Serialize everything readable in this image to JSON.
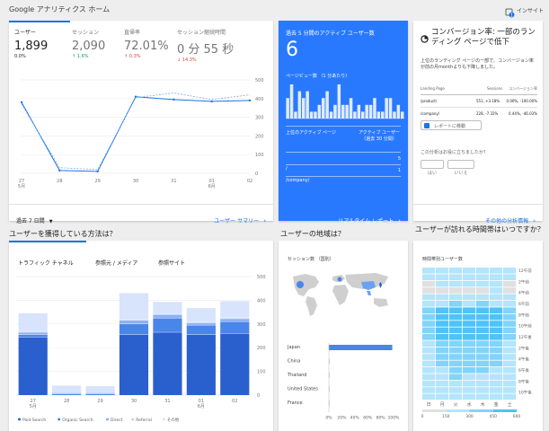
{
  "header": {
    "title": "Google アナリティクス ホーム",
    "insight_label": "インサイト",
    "insight_badge": "1"
  },
  "overview": {
    "metrics": [
      {
        "label": "ユーザー",
        "value": "1,899",
        "delta": "0.0%",
        "dir": "flat"
      },
      {
        "label": "セッション",
        "value": "2,090",
        "delta": "1.6%",
        "dir": "up"
      },
      {
        "label": "直帰率",
        "value": "72.01%",
        "delta": "0.3%",
        "dir": "down"
      },
      {
        "label": "セッション継続時間",
        "value": "0 分 55 秒",
        "delta": "14.3%",
        "dir": "down"
      }
    ],
    "chart_data": {
      "type": "line",
      "x": [
        "27 5月",
        "28",
        "29",
        "30",
        "31",
        "01 6月",
        "02"
      ],
      "xticks": [
        [
          "27",
          "5月"
        ],
        [
          "28"
        ],
        [
          "29"
        ],
        [
          "30"
        ],
        [
          "31"
        ],
        [
          "01",
          "6月"
        ],
        [
          "02"
        ]
      ],
      "series": [
        {
          "values": [
            380,
            15,
            10,
            410,
            395,
            385,
            390
          ],
          "style": "solid"
        },
        {
          "values": [
            370,
            30,
            20,
            405,
            430,
            395,
            420
          ],
          "style": "dashed"
        }
      ],
      "yticks": [
        "500",
        "400",
        "300",
        "200",
        "100",
        "0"
      ],
      "ylim": [
        0,
        500
      ]
    },
    "date_range": "過去 7 日間",
    "footer_link": "ユーザー サマリー"
  },
  "realtime": {
    "title": "過去 5 分間のアクティブ ユーザー数",
    "count": "6",
    "pageview_label": "ページビュー数 （1 分あたり）",
    "pageviews_per_min": [
      3,
      5,
      1,
      4,
      3,
      4,
      1,
      1,
      2,
      3,
      4,
      1,
      2,
      5,
      2,
      2,
      3,
      1,
      2,
      1,
      2,
      2,
      3,
      1,
      1,
      3,
      3,
      1,
      2,
      1
    ],
    "table_head_left": "上位のアクティブ ページ",
    "table_head_right": "アクティブ ユーザー （過去 30 分間）",
    "rows": [
      {
        "page": "/",
        "users": "5"
      },
      {
        "page": "/company/",
        "users": "1"
      }
    ],
    "footer_link": "リアルタイム レポート"
  },
  "conversion": {
    "title": "コンバージョン率: 一部のランディング ページで低下",
    "desc": "上位のランディング ページの一部で、コンバージョン率が前の月monthよりも下降しました。",
    "col_landing": "Landing Page",
    "col_sessions": "Sessions",
    "col_rate": "コンバージョン率",
    "rows": [
      {
        "page": "/product/",
        "sessions": "551, +3.18%",
        "rate": "0.00%, -100.00%"
      },
      {
        "page": "/company/",
        "sessions": "228, -7.32%",
        "rate": "0.44%, -46.03%"
      }
    ],
    "report_button": "レポートに移動",
    "question": "この分析はお役に立ちましたか？",
    "yes": "はい",
    "no": "いいえ",
    "footer_link": "その他の分析情報"
  },
  "acquisition": {
    "section_title": "ユーザーを獲得している方法は？",
    "tabs": [
      "トラフィック チャネル",
      "参照元 / メディア",
      "参照サイト"
    ],
    "chart_data": {
      "type": "bar",
      "categories": [
        "27 5月",
        "28",
        "29",
        "30",
        "31",
        "01 6月",
        "02"
      ],
      "xticks": [
        [
          "27",
          "5月"
        ],
        [
          "28"
        ],
        [
          "29"
        ],
        [
          "30"
        ],
        [
          "31"
        ],
        [
          "01",
          "6月"
        ],
        [
          "02"
        ]
      ],
      "series": [
        {
          "name": "Paid Search",
          "values": [
            245,
            0,
            0,
            255,
            265,
            255,
            260
          ],
          "color": "#2a5fce"
        },
        {
          "name": "Organic Search",
          "values": [
            10,
            5,
            5,
            45,
            60,
            40,
            50
          ],
          "color": "#4a85ea"
        },
        {
          "name": "Direct",
          "values": [
            10,
            5,
            5,
            15,
            15,
            10,
            12
          ],
          "color": "#8cb1f5"
        },
        {
          "name": "Referral",
          "values": [
            0,
            0,
            0,
            5,
            3,
            2,
            4
          ],
          "color": "#c2d5f9"
        },
        {
          "name": "その他",
          "values": [
            80,
            30,
            28,
            110,
            50,
            60,
            70
          ],
          "color": "#d8e3fc"
        }
      ],
      "yticks": [
        "500",
        "400",
        "300",
        "200",
        "100",
        "0"
      ],
      "ylim": [
        0,
        500
      ]
    }
  },
  "geo": {
    "section_title": "ユーザーの地域は？",
    "subtitle": "セッション数 （国別）",
    "chart_data": {
      "type": "bar",
      "categories": [
        "Japan",
        "China",
        "Thailand",
        "United States",
        "France"
      ],
      "values": [
        98,
        0.6,
        0.4,
        0.3,
        0.2
      ],
      "xticks": [
        "0%",
        "20%",
        "40%",
        "60%",
        "80%",
        "100%"
      ],
      "xlim": [
        0,
        100
      ]
    }
  },
  "time": {
    "section_title": "ユーザーが訪れる時間帯はいつですか？",
    "subtitle": "時間帯別ユーザー数",
    "hours": [
      "12午前",
      "2午前",
      "4午前",
      "6午前",
      "8午前",
      "10午前",
      "12午後",
      "2午後",
      "4午後",
      "6午後",
      "8午後",
      "10午後"
    ],
    "days": [
      "日",
      "月",
      "火",
      "水",
      "木",
      "金",
      "土"
    ],
    "scale": [
      "0",
      "150",
      "300",
      "450",
      "600"
    ],
    "grid": [
      [
        1,
        1,
        1,
        1,
        1,
        1,
        1
      ],
      [
        1,
        1,
        1,
        1,
        1,
        1,
        1
      ],
      [
        0,
        1,
        1,
        1,
        1,
        1,
        0
      ],
      [
        0,
        0,
        0,
        0,
        0,
        1,
        0
      ],
      [
        1,
        1,
        1,
        1,
        1,
        1,
        1
      ],
      [
        1,
        1,
        2,
        1,
        2,
        1,
        1
      ],
      [
        2,
        3,
        3,
        3,
        3,
        3,
        2
      ],
      [
        2,
        3,
        3,
        3,
        3,
        3,
        2
      ],
      [
        2,
        3,
        3,
        3,
        3,
        3,
        2
      ],
      [
        2,
        3,
        3,
        3,
        3,
        3,
        2
      ],
      [
        2,
        3,
        3,
        3,
        3,
        3,
        2
      ],
      [
        1,
        2,
        2,
        2,
        2,
        2,
        1
      ],
      [
        1,
        2,
        2,
        2,
        2,
        2,
        1
      ],
      [
        1,
        2,
        2,
        2,
        2,
        2,
        1
      ],
      [
        1,
        2,
        2,
        2,
        2,
        2,
        1
      ],
      [
        1,
        1,
        2,
        2,
        2,
        1,
        1
      ],
      [
        1,
        1,
        2,
        1,
        1,
        1,
        1
      ],
      [
        1,
        1,
        1,
        1,
        1,
        1,
        1
      ],
      [
        1,
        1,
        1,
        1,
        1,
        1,
        1
      ],
      [
        1,
        1,
        1,
        1,
        1,
        1,
        1
      ]
    ]
  },
  "colors": {
    "accent": "#1a73e8",
    "realtime_bg": "#2979ff",
    "up": "#0f9d58",
    "down": "#db4437"
  }
}
